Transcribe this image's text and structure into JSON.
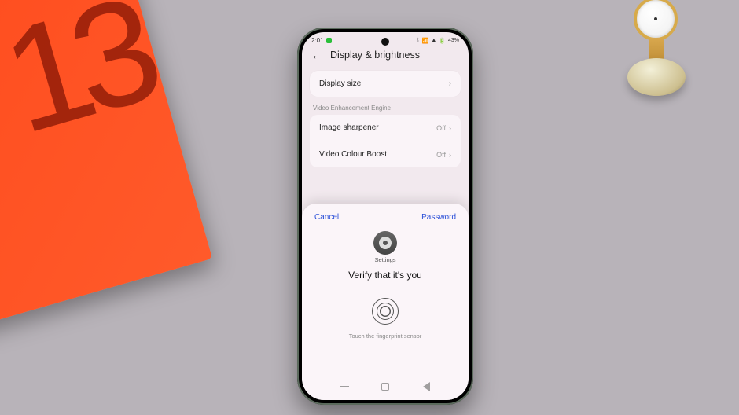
{
  "box": {
    "text": "13"
  },
  "statusbar": {
    "time": "2:01",
    "battery_text": "43%"
  },
  "header": {
    "title": "Display & brightness"
  },
  "display_size": {
    "label": "Display size"
  },
  "video_section": {
    "label": "Video Enhancement Engine"
  },
  "rows": {
    "sharpener": {
      "label": "Image sharpener",
      "state": "Off"
    },
    "colour": {
      "label": "Video Colour Boost",
      "state": "Off"
    }
  },
  "sheet": {
    "cancel": "Cancel",
    "password": "Password",
    "app_label": "Settings",
    "verify": "Verify that it's you",
    "hint": "Touch the fingerprint sensor"
  }
}
